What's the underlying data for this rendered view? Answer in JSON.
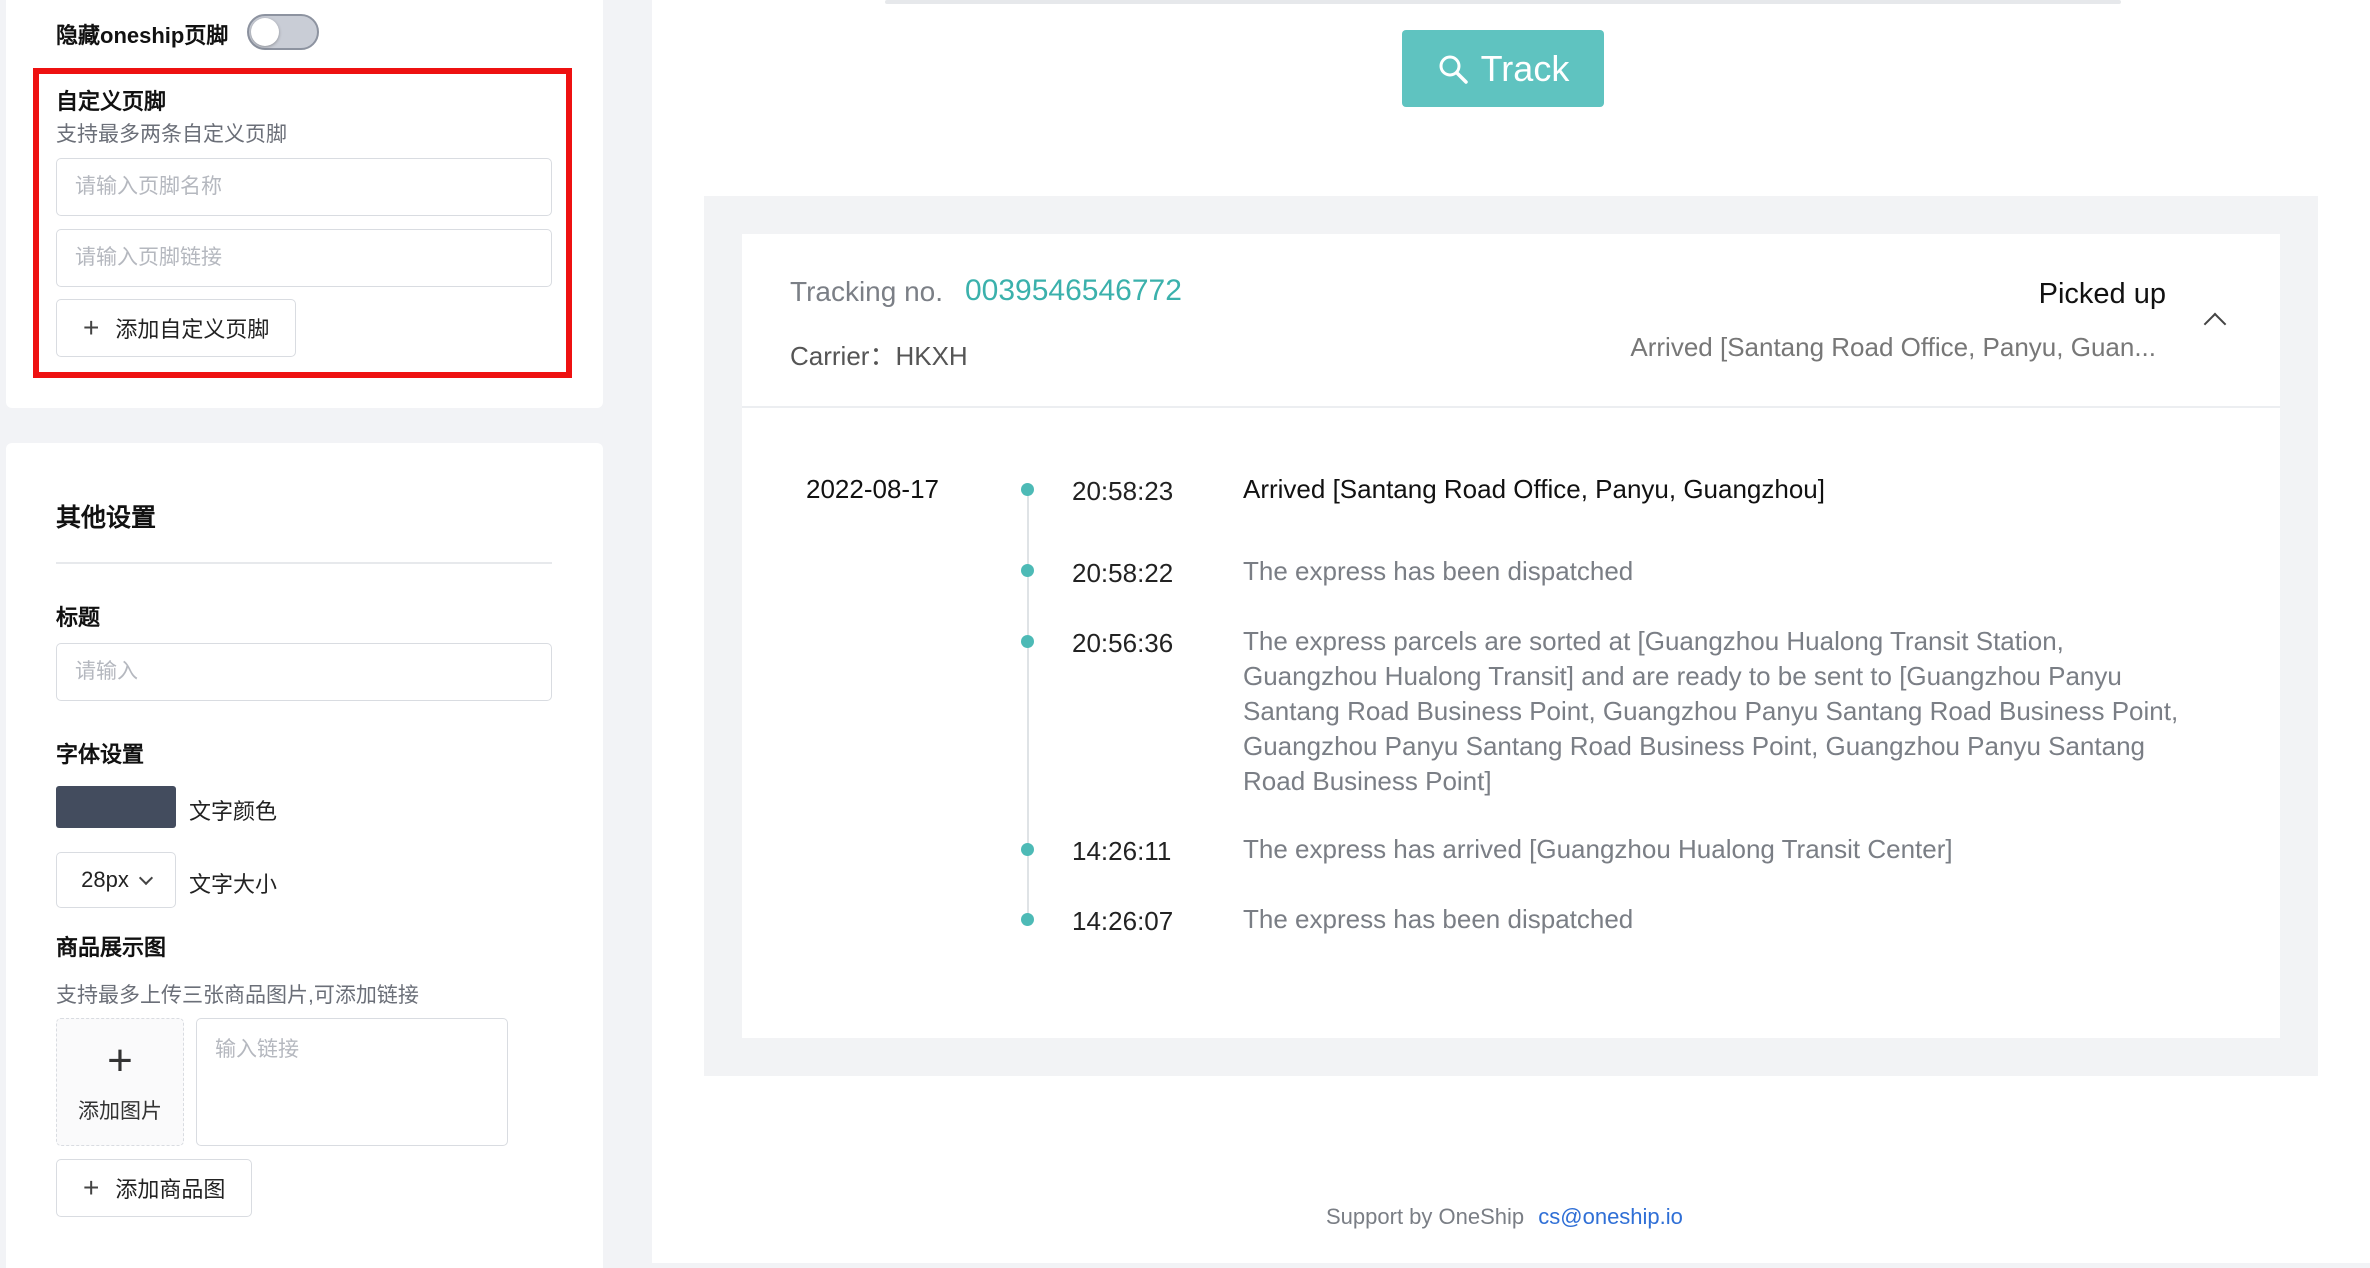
{
  "footer_settings": {
    "hide_footer_label": "隐藏oneship页脚",
    "custom_footer_label": "自定义页脚",
    "custom_footer_hint": "支持最多两条自定义页脚",
    "footer_name_placeholder": "请输入页脚名称",
    "footer_link_placeholder": "请输入页脚链接",
    "add_footer_button": "添加自定义页脚"
  },
  "other_settings": {
    "section_title": "其他设置",
    "title_label": "标题",
    "title_placeholder": "请输入",
    "font_settings_label": "字体设置",
    "text_color_label": "文字颜色",
    "text_color": "#434c5e",
    "font_size_value": "28px",
    "font_size_label": "文字大小",
    "product_image_label": "商品展示图",
    "product_image_hint": "支持最多上传三张商品图片,可添加链接",
    "add_image_label": "添加图片",
    "link_placeholder": "输入链接",
    "add_product_image_button": "添加商品图"
  },
  "preview": {
    "track_button": "Track",
    "tracking_label": "Tracking no.",
    "tracking_number": "0039546546772",
    "carrier_label": "Carrier：HKXH",
    "status": "Picked up",
    "latest_event": "Arrived [Santang Road Office, Panyu, Guan...",
    "date": "2022-08-17",
    "events": [
      {
        "time": "20:58:23",
        "text": "Arrived [Santang Road Office, Panyu, Guangzhou]"
      },
      {
        "time": "20:58:22",
        "text": "The express has been dispatched"
      },
      {
        "time": "20:56:36",
        "text": "The express parcels are sorted at [Guangzhou Hualong Transit Station, Guangzhou Hualong Transit] and are ready to be sent to [Guangzhou Panyu Santang Road Business Point, Guangzhou Panyu Santang Road Business Point, Guangzhou Panyu Santang Road Business Point, Guangzhou Panyu Santang Road Business Point]"
      },
      {
        "time": "14:26:11",
        "text": "The express has arrived [Guangzhou Hualong Transit Center]"
      },
      {
        "time": "14:26:07",
        "text": "The express has been dispatched"
      }
    ],
    "footer_text": "Support by OneShip",
    "footer_email": "cs@oneship.io",
    "accent_color": "#5fc3c0"
  }
}
